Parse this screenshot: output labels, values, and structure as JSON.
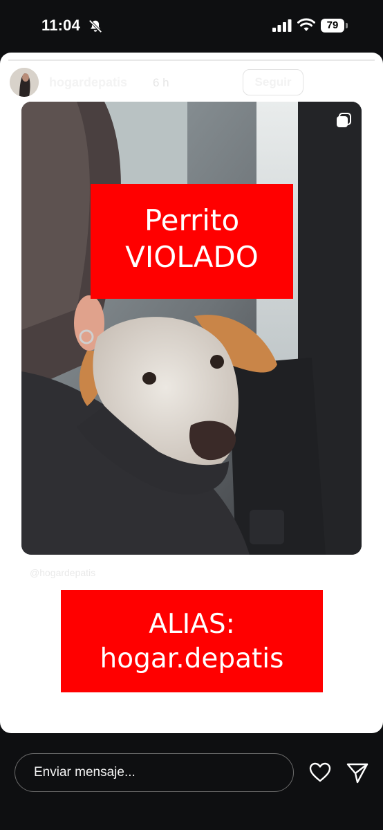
{
  "status_bar": {
    "time": "11:04",
    "battery": "79"
  },
  "story": {
    "progress": 1.0,
    "username": "hogardepatis",
    "time_ago": "6 h",
    "follow_label": "Seguir",
    "headline_line1": "Perrito",
    "headline_line2": "VIOLADO",
    "watermark": "@hogardepatis",
    "alias_line1": "ALIAS:",
    "alias_line2": "hogar.depatis",
    "accent_color": "#ff0000"
  },
  "footer": {
    "message_placeholder": "Enviar mensaje..."
  },
  "icons": {
    "mute": "bell-slash-icon",
    "signal": "cellular-signal-icon",
    "wifi": "wifi-icon",
    "more": "ellipsis-icon",
    "close": "close-icon",
    "multi": "multiple-photos-icon",
    "like": "heart-icon",
    "share": "send-icon"
  }
}
